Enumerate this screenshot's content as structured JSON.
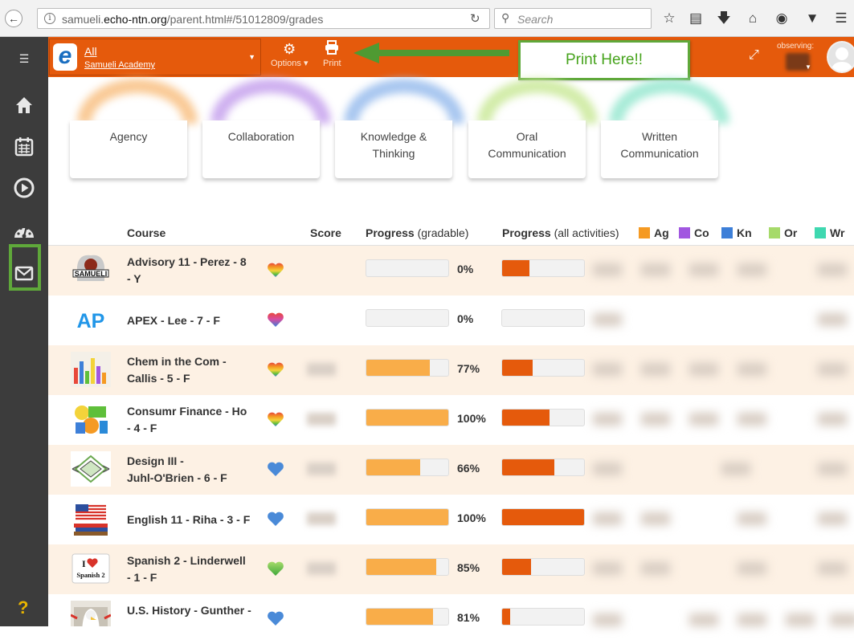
{
  "browser": {
    "url_prefix": "samueli.",
    "url_domain": "echo-ntn.org",
    "url_suffix": "/parent.html#/51012809/grades",
    "search_placeholder": "Search"
  },
  "topbar": {
    "brand_all": "All",
    "brand_school": "Samueli Academy",
    "options_label": "Options",
    "print_label": "Print",
    "observing_label": "observing:"
  },
  "callout": {
    "text": "Print Here!!"
  },
  "competencies": [
    {
      "line1": "Agency",
      "line2": ""
    },
    {
      "line1": "Collaboration",
      "line2": ""
    },
    {
      "line1": "Knowledge &",
      "line2": "Thinking"
    },
    {
      "line1": "Oral",
      "line2": "Communication"
    },
    {
      "line1": "Written",
      "line2": "Communication"
    }
  ],
  "table": {
    "headers": {
      "course": "Course",
      "score": "Score",
      "progress_gradable_bold": "Progress",
      "progress_gradable_lite": "(gradable)",
      "progress_all_bold": "Progress",
      "progress_all_lite": "(all activities)"
    },
    "legend": [
      {
        "abbr": "Ag",
        "color": "#f59a23"
      },
      {
        "abbr": "Co",
        "color": "#a157e0"
      },
      {
        "abbr": "Kn",
        "color": "#3d7fd8"
      },
      {
        "abbr": "Or",
        "color": "#a6da6a"
      },
      {
        "abbr": "Wr",
        "color": "#3fd8b0"
      }
    ],
    "rows": [
      {
        "line1": "Advisory 11 - Perez - 8",
        "line2": "- Y",
        "thumb": "samueli-logo",
        "heart": "rainbow",
        "gradable_pct": "0%",
        "gradable": 0.0,
        "all": 0.33
      },
      {
        "line1": "APEX - Lee - 7 - F",
        "line2": "",
        "thumb": "ap-logo",
        "heart": "pink-blue",
        "gradable_pct": "0%",
        "gradable": 0.0,
        "all": 0.0
      },
      {
        "line1": "Chem in the Com -",
        "line2": "Callis - 5 - F",
        "thumb": "chemistry",
        "heart": "rainbow",
        "gradable_pct": "77%",
        "gradable": 0.77,
        "all": 0.37
      },
      {
        "line1": "Consumr Finance - Ho",
        "line2": "- 4 - F",
        "thumb": "finance",
        "heart": "rainbow",
        "gradable_pct": "100%",
        "gradable": 1.0,
        "all": 0.58
      },
      {
        "line1": "Design III -",
        "line2": "Juhl-O'Brien - 6 - F",
        "thumb": "design",
        "heart": "blue",
        "gradable_pct": "66%",
        "gradable": 0.66,
        "all": 0.64
      },
      {
        "line1": "English 11 - Riha - 3 - F",
        "line2": "",
        "thumb": "english-flag-books",
        "heart": "blue",
        "gradable_pct": "100%",
        "gradable": 1.0,
        "all": 1.0
      },
      {
        "line1": "Spanish 2 - Linderwell",
        "line2": "- 1 - F",
        "thumb": "i-love-spanish",
        "heart": "green",
        "gradable_pct": "85%",
        "gradable": 0.85,
        "all": 0.35
      },
      {
        "line1": "U.S. History - Gunther -",
        "line2": "",
        "thumb": "eagle-flag",
        "heart": "blue",
        "gradable_pct": "81%",
        "gradable": 0.81,
        "all": 0.1
      }
    ]
  }
}
